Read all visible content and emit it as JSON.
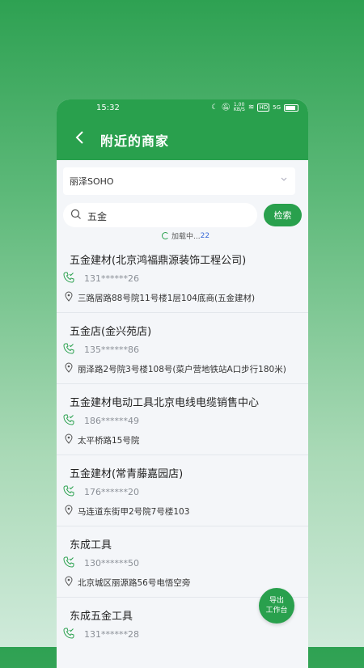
{
  "status_bar": {
    "time": "15:32",
    "speed": "1.00 KB/S",
    "hd": "HD",
    "signal": "5G"
  },
  "header": {
    "title": "附近的商家"
  },
  "location": {
    "value": "丽泽SOHO"
  },
  "search": {
    "query": "五金",
    "button_label": "检索"
  },
  "loading": {
    "text": "加载中...",
    "count": "22"
  },
  "merchants": [
    {
      "name": "五金建材(北京鸿福鼎源装饰工程公司)",
      "phone": "131******26",
      "address": "三路居路88号院11号楼1层104底商(五金建材)"
    },
    {
      "name": "五金店(金兴苑店)",
      "phone": "135******86",
      "address": "丽泽路2号院3号楼108号(菜户营地铁站A口步行180米)"
    },
    {
      "name": "五金建材电动工具北京电线电缆销售中心",
      "phone": "186******49",
      "address": "太平桥路15号院"
    },
    {
      "name": "五金建材(常青藤嘉园店)",
      "phone": "176******20",
      "address": "马连道东街甲2号院7号楼103"
    },
    {
      "name": "东成工具",
      "phone": "130******50",
      "address": "北京城区丽源路56号电悟空旁"
    },
    {
      "name": "东成五金工具",
      "phone": "131******28",
      "address": ""
    }
  ],
  "fab": {
    "line1": "导出",
    "line2": "工作台"
  },
  "colors": {
    "primary": "#29a04d",
    "page_bg": "#f4f6f9"
  }
}
